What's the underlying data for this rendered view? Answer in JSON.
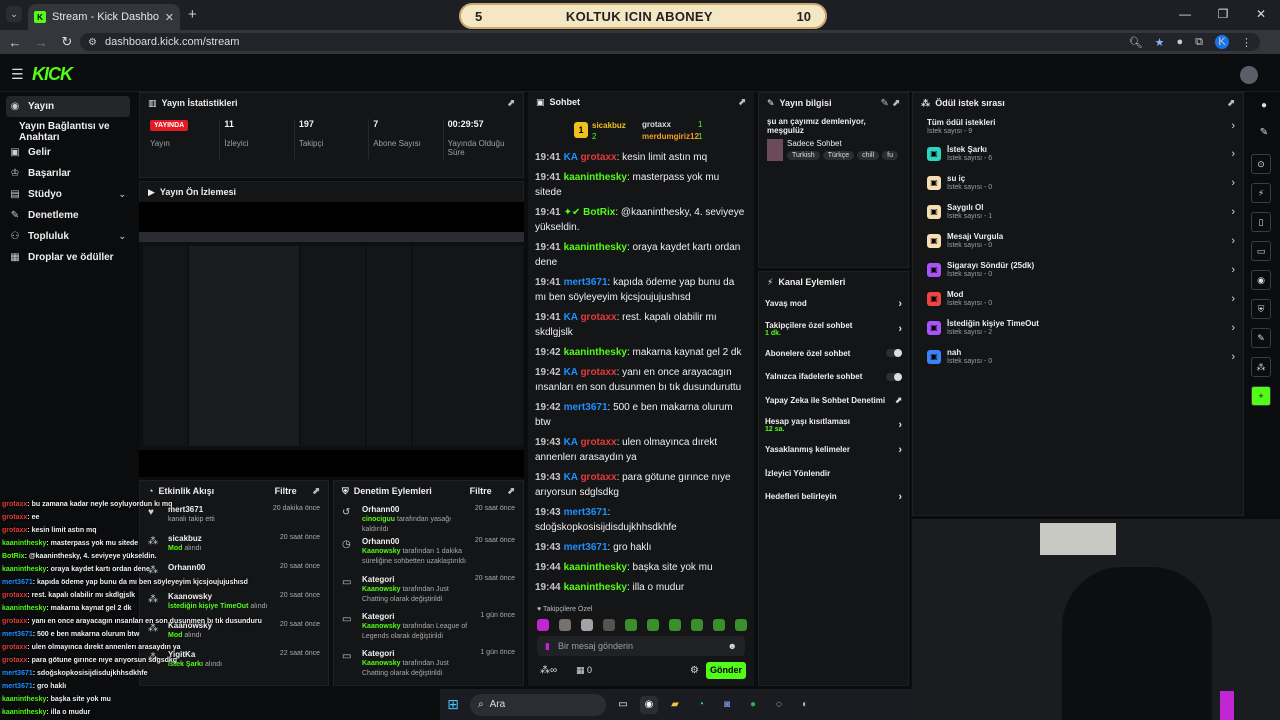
{
  "browser": {
    "tab_title": "Stream - Kick Dashboard",
    "url": "dashboard.kick.com/stream",
    "account_initial": "K"
  },
  "overlay": {
    "left_num": "5",
    "title": "KOLTUK ICIN ABONEY",
    "right_num": "10"
  },
  "logo": "KICK",
  "sidebar": {
    "items": [
      {
        "label": "Yayın",
        "icon": "broadcast-icon"
      },
      {
        "label": "Yayın Bağlantısı ve Anahtarı",
        "icon": ""
      },
      {
        "label": "Gelir",
        "icon": "dollar-icon"
      },
      {
        "label": "Başarılar",
        "icon": "trophy-icon"
      },
      {
        "label": "Stüdyo",
        "icon": "studio-icon"
      },
      {
        "label": "Denetleme",
        "icon": "wrench-icon"
      },
      {
        "label": "Topluluk",
        "icon": "users-icon"
      },
      {
        "label": "Droplar ve ödüller",
        "icon": "gift-icon"
      }
    ]
  },
  "stats": {
    "title": "Yayın İstatistikleri",
    "live_badge": "YAYINDA",
    "items": [
      {
        "value": "",
        "label": "Yayın"
      },
      {
        "value": "11",
        "label": "İzleyici"
      },
      {
        "value": "197",
        "label": "Takipçi"
      },
      {
        "value": "7",
        "label": "Abone Sayısı"
      },
      {
        "value": "00:29:57",
        "label": "Yayında Olduğu Süre"
      }
    ]
  },
  "preview": {
    "title": "Yayın Ön İzlemesi"
  },
  "activity": {
    "title": "Etkinlik Akışı",
    "filter": "Filtre",
    "items": [
      {
        "name": "mert3671",
        "sub": "kanalı takip etti",
        "sub2": "",
        "time": "20 dakika önce"
      },
      {
        "name": "sicakbuz",
        "sub": "Mod",
        "sub2": " alındı",
        "time": "20 saat önce"
      },
      {
        "name": "Orhann00",
        "sub": "",
        "sub2": "",
        "time": "20 saat önce"
      },
      {
        "name": "Kaanowsky",
        "sub": "İstediğin kişiye TimeOut",
        "sub2": " alındı",
        "time": "20 saat önce"
      },
      {
        "name": "Kaanowsky",
        "sub": "Mod",
        "sub2": " alındı",
        "time": "20 saat önce"
      },
      {
        "name": "YigitKa",
        "sub": "İstek Şarkı",
        "sub2": " alındı",
        "time": "22 saat önce"
      }
    ]
  },
  "moderation": {
    "title": "Denetim Eylemleri",
    "filter": "Filtre",
    "items": [
      {
        "name": "Orhann00",
        "actor": "cinociguu",
        "text": " tarafından yasağı kaldırıldı",
        "time": "20 saat önce"
      },
      {
        "name": "Orhann00",
        "actor": "Kaanowsky",
        "text": " tarafından 1 dakika süreliğine sohbetten uzaklaştırıldı",
        "time": "20 saat önce"
      },
      {
        "name": "Kategori",
        "actor": "Kaanowsky",
        "text": " tarafından Just Chatting olarak değiştirildi",
        "time": "20 saat önce"
      },
      {
        "name": "Kategori",
        "actor": "Kaanowsky",
        "text": " tarafından League of Legends olarak değiştirildi",
        "time": "1 gün önce"
      },
      {
        "name": "Kategori",
        "actor": "Kaanowsky",
        "text": " tarafından Just Chatting olarak değiştirildi",
        "time": "1 gün önce"
      }
    ]
  },
  "chat": {
    "title": "Sohbet",
    "leaders": [
      {
        "rank": "1",
        "name": "sicakbuz",
        "count": "2"
      },
      {
        "name": "grotaxx",
        "count": "1"
      },
      {
        "name": "merdumgiriz12",
        "count": "1"
      }
    ],
    "messages": [
      {
        "time": "19:41",
        "user": "grotaxx",
        "cls": "u-g",
        "badge": "KA",
        "text": "kesin limit astın mq"
      },
      {
        "time": "19:41",
        "user": "kaaninthesky",
        "cls": "u-k",
        "badge": "",
        "text": "masterpass yok mu sitede"
      },
      {
        "time": "19:41",
        "user": "BotRix",
        "cls": "u-b",
        "badge": "bot",
        "text": "@kaaninthesky, 4. seviyeye yükseldin."
      },
      {
        "time": "19:41",
        "user": "kaaninthesky",
        "cls": "u-k",
        "badge": "",
        "text": "oraya kaydet kartı ordan dene"
      },
      {
        "time": "19:41",
        "user": "mert3671",
        "cls": "u-m",
        "badge": "",
        "text": "kapıda ödeme yap bunu da mı ben söyleyeyim kjcsjoujujushısd"
      },
      {
        "time": "19:41",
        "user": "grotaxx",
        "cls": "u-g",
        "badge": "KA",
        "text": "rest. kapalı olabilir mı skdlgjslk"
      },
      {
        "time": "19:42",
        "user": "kaaninthesky",
        "cls": "u-k",
        "badge": "",
        "text": "makarna kaynat gel 2 dk"
      },
      {
        "time": "19:42",
        "user": "grotaxx",
        "cls": "u-g",
        "badge": "KA",
        "text": "yanı en once arayacagın ınsanları en son dusunmen bı tık dusunduruttu"
      },
      {
        "time": "19:42",
        "user": "mert3671",
        "cls": "u-m",
        "badge": "",
        "text": "500 e ben makarna olurum btw"
      },
      {
        "time": "19:43",
        "user": "grotaxx",
        "cls": "u-g",
        "badge": "KA",
        "text": "ulen olmayınca dırekt annenlerı arasaydın ya"
      },
      {
        "time": "19:43",
        "user": "grotaxx",
        "cls": "u-g",
        "badge": "KA",
        "text": "para götune gırınce nıye arıyorsun sdglsdkg"
      },
      {
        "time": "19:43",
        "user": "mert3671",
        "cls": "u-m",
        "badge": "",
        "text": "sdoğskopkosisijdisdujkhhsdkhfe"
      },
      {
        "time": "19:43",
        "user": "mert3671",
        "cls": "u-m",
        "badge": "",
        "text": "gro haklı"
      },
      {
        "time": "19:44",
        "user": "kaaninthesky",
        "cls": "u-k",
        "badge": "",
        "text": "başka site yok mu"
      },
      {
        "time": "19:44",
        "user": "kaaninthesky",
        "cls": "u-k",
        "badge": "",
        "text": "illa o mudur"
      }
    ],
    "followers_only": "Takipçilere Özel",
    "input_placeholder": "Bir mesaj gönderin",
    "count": "0",
    "send": "Gönder"
  },
  "stream_info": {
    "title": "Yayın bilgisi",
    "stream_title": "şu an çayımız demleniyor, meşgulüz",
    "category": "Sadece Sohbet",
    "tags": [
      "Turkish",
      "Türkçe",
      "chill",
      "fu"
    ]
  },
  "channel_actions": {
    "title": "Kanal Eylemleri",
    "rows": [
      {
        "label": "Yavaş mod",
        "sub": "",
        "control": "arrow"
      },
      {
        "label": "Takipçilere özel sohbet",
        "sub": "1 dk.",
        "control": "arrow"
      },
      {
        "label": "Abonelere özel sohbet",
        "sub": "",
        "control": "toggle"
      },
      {
        "label": "Yalnızca ifadelerle sohbet",
        "sub": "",
        "control": "toggle"
      },
      {
        "label": "Yapay Zeka ile Sohbet Denetimi",
        "sub": "",
        "control": "ext"
      },
      {
        "label": "Hesap yaşı kısıtlaması",
        "sub": "12 sa.",
        "control": "arrow"
      },
      {
        "label": "Yasaklanmış kelimeler",
        "sub": "",
        "control": "arrow"
      },
      {
        "label": "İzleyici Yönlendir",
        "sub": "",
        "control": ""
      },
      {
        "label": "Hedefleri belirleyin",
        "sub": "",
        "control": "arrow"
      }
    ]
  },
  "rewards": {
    "title": "Ödül istek sırası",
    "all_label": "Tüm ödül istekleri",
    "all_sub": "İstek sayısı - 9",
    "items": [
      {
        "name": "İstek Şarkı",
        "count": "İstek sayısı - 6",
        "color": "#2dd4bf"
      },
      {
        "name": "su iç",
        "count": "İstek sayısı - 0",
        "color": "#f5deb3"
      },
      {
        "name": "Saygılı Ol",
        "count": "İstek sayısı - 1",
        "color": "#f5deb3"
      },
      {
        "name": "Mesajı Vurgula",
        "count": "İstek sayısı - 0",
        "color": "#f5deb3"
      },
      {
        "name": "Sigarayı Söndür (25dk)",
        "count": "İstek sayısı - 0",
        "color": "#a855f7"
      },
      {
        "name": "Mod",
        "count": "İstek sayısı - 0",
        "color": "#ef4444"
      },
      {
        "name": "İstediğin kişiye TimeOut",
        "count": "İstek sayısı - 2",
        "color": "#a855f7"
      },
      {
        "name": "nah",
        "count": "İstek sayısı - 0",
        "color": "#3b82f6"
      }
    ]
  },
  "overlay_chat": [
    {
      "user": "grotaxx",
      "cls": "u-g",
      "text": ": bu zamana kadar neyle soyluyordun kı mq"
    },
    {
      "user": "grotaxx",
      "cls": "u-g",
      "text": ": ee"
    },
    {
      "user": "grotaxx",
      "cls": "u-g",
      "text": ": kesin limit astın mq"
    },
    {
      "user": "kaaninthesky",
      "cls": "u-k",
      "text": ": masterpass yok mu sitede"
    },
    {
      "user": "BotRix",
      "cls": "u-b",
      "text": ": @kaaninthesky, 4. seviyeye yükseldin."
    },
    {
      "user": "kaaninthesky",
      "cls": "u-k",
      "text": ": oraya kaydet kartı ordan dene"
    },
    {
      "user": "mert3671",
      "cls": "u-m",
      "text": ": kapıda ödeme yap bunu da mı ben söyleyeyim kjcsjoujujushısd"
    },
    {
      "user": "grotaxx",
      "cls": "u-g",
      "text": ": rest. kapalı olabilir mı skdlgjslk"
    },
    {
      "user": "kaaninthesky",
      "cls": "u-k",
      "text": ": makarna kaynat gel 2 dk"
    },
    {
      "user": "grotaxx",
      "cls": "u-g",
      "text": ": yanı en once arayacagın ınsanları en son dusunmen bı tık dusunduruttu"
    },
    {
      "user": "mert3671",
      "cls": "u-m",
      "text": ": 500 e ben makarna olurum btw"
    },
    {
      "user": "grotaxx",
      "cls": "u-g",
      "text": ": ulen olmayınca dırekt annenlerı arasaydın ya"
    },
    {
      "user": "grotaxx",
      "cls": "u-g",
      "text": ": para götune gırınce nıye arıyorsun sdgsdkg"
    },
    {
      "user": "mert3671",
      "cls": "u-m",
      "text": ": sdoğskopkosisijdisdujkhhsdkhfe"
    },
    {
      "user": "mert3671",
      "cls": "u-m",
      "text": ": gro haklı"
    },
    {
      "user": "kaaninthesky",
      "cls": "u-k",
      "text": ": başka site yok mu"
    },
    {
      "user": "kaaninthesky",
      "cls": "u-k",
      "text": ": illa o mudur"
    }
  ],
  "taskbar": {
    "search": "Ara"
  }
}
